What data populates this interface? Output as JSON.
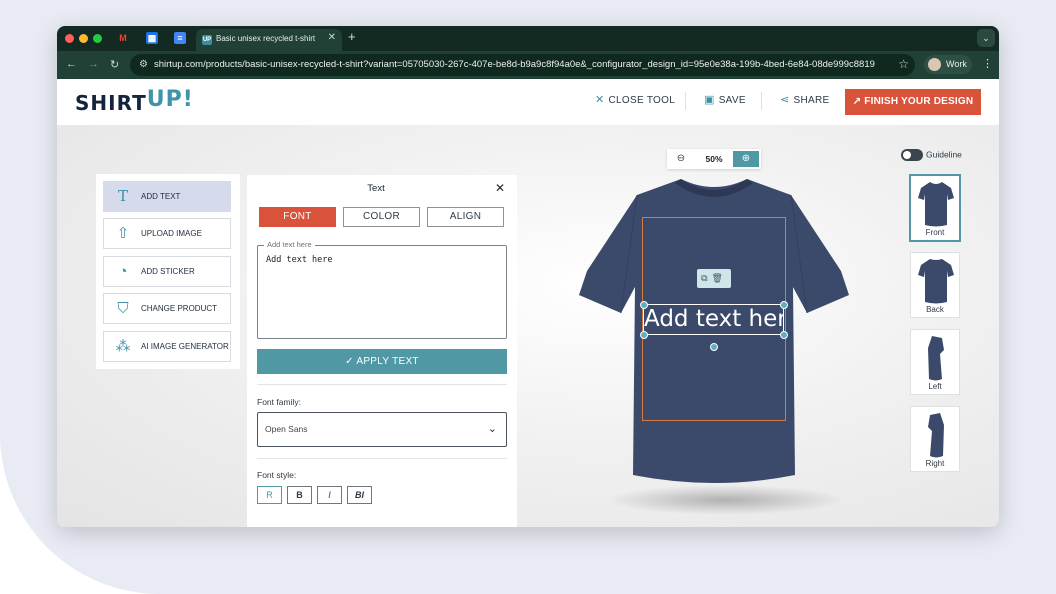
{
  "browser": {
    "tab_title": "Basic unisex recycled t-shirt",
    "tab_favicon": "UP",
    "url": "shirtup.com/products/basic-unisex-recycled-t-shirt?variant=05705030-267c-407e-be8d-b9a9c8f94a0e&_configurator_design_id=95e0e38a-199b-4bed-6e84-08de999c8819",
    "profile": "Work"
  },
  "header": {
    "logo_main": "SHIRT",
    "logo_accent": "UP!",
    "close_label": "CLOSE TOOL",
    "save_label": "SAVE",
    "share_label": "SHARE",
    "finish_label": "FINISH YOUR DESIGN"
  },
  "tools": {
    "items": [
      {
        "label": "ADD TEXT",
        "icon": "text-icon"
      },
      {
        "label": "UPLOAD IMAGE",
        "icon": "upload-icon"
      },
      {
        "label": "ADD STICKER",
        "icon": "sticker-icon"
      },
      {
        "label": "CHANGE PRODUCT",
        "icon": "tshirt-icon"
      },
      {
        "label": "AI IMAGE GENERATOR",
        "icon": "magic-wand-icon"
      }
    ]
  },
  "panel": {
    "title": "Text",
    "tabs": [
      "FONT",
      "COLOR",
      "ALIGN"
    ],
    "text_legend": "Add text here",
    "text_value": "Add text here",
    "apply_label": "APPLY TEXT",
    "font_family_label": "Font family:",
    "font_family_value": "Open Sans",
    "font_style_label": "Font style:",
    "font_styles": [
      "R",
      "B",
      "I",
      "BI"
    ]
  },
  "canvas": {
    "zoom": "50%",
    "guideline_label": "Guideline",
    "design_text": "Add text here",
    "shirt_color": "#3b4a6b"
  },
  "views": [
    "Front",
    "Back",
    "Left",
    "Right"
  ],
  "colors": {
    "accent": "#d9533a",
    "teal": "#4f98a4"
  }
}
